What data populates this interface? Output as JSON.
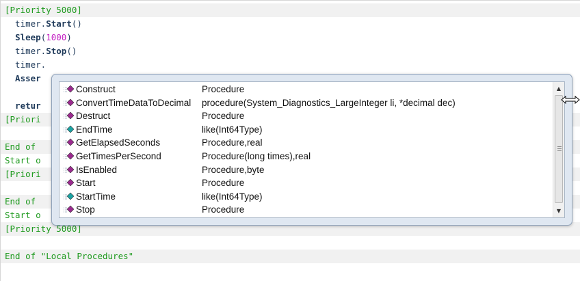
{
  "editor": {
    "lines": [
      {
        "text": "[Priority 5000]",
        "style": "green",
        "band": true
      },
      {
        "parts": [
          {
            "t": "  timer.",
            "c": "dark"
          },
          {
            "t": "Start",
            "c": "kw"
          },
          {
            "t": "()",
            "c": "dark"
          }
        ]
      },
      {
        "parts": [
          {
            "t": "  ",
            "c": "dark"
          },
          {
            "t": "Sleep",
            "c": "kw"
          },
          {
            "t": "(",
            "c": "dark"
          },
          {
            "t": "1000",
            "c": "num"
          },
          {
            "t": ")",
            "c": "dark"
          }
        ]
      },
      {
        "parts": [
          {
            "t": "  timer.",
            "c": "dark"
          },
          {
            "t": "Stop",
            "c": "kw"
          },
          {
            "t": "()",
            "c": "dark"
          }
        ]
      },
      {
        "parts": [
          {
            "t": "  timer.",
            "c": "dark"
          }
        ]
      },
      {
        "parts": [
          {
            "t": "  Asser",
            "c": "kw"
          }
        ]
      },
      {
        "parts": [
          {
            "t": "",
            "c": "dark"
          }
        ]
      },
      {
        "parts": [
          {
            "t": "  retur",
            "c": "kw"
          }
        ]
      },
      {
        "text": "[Priori",
        "style": "green",
        "band": true
      },
      {
        "parts": [
          {
            "t": "",
            "c": "dark"
          }
        ]
      },
      {
        "text": "End of ",
        "style": "green",
        "band": true
      },
      {
        "text": "Start o",
        "style": "green"
      },
      {
        "text": "[Priori",
        "style": "green",
        "band": true
      },
      {
        "parts": [
          {
            "t": "",
            "c": "dark"
          }
        ]
      },
      {
        "text": "End of ",
        "style": "green",
        "band": true
      },
      {
        "text": "Start o",
        "style": "green"
      },
      {
        "text": "[Priority 5000]",
        "style": "green",
        "band": true
      },
      {
        "parts": [
          {
            "t": "",
            "c": "dark"
          }
        ]
      },
      {
        "text": "End of \"Local Procedures\"",
        "style": "green",
        "band": true
      }
    ]
  },
  "autocomplete": {
    "items": [
      {
        "name": "Construct",
        "signature": "Procedure",
        "icon": "method-icon"
      },
      {
        "name": "ConvertTimeDataToDecimal",
        "signature": "procedure(System_Diagnostics_LargeInteger li, *decimal dec)",
        "icon": "method-icon"
      },
      {
        "name": "Destruct",
        "signature": "Procedure",
        "icon": "method-icon"
      },
      {
        "name": "EndTime",
        "signature": "like(Int64Type)",
        "icon": "property-icon"
      },
      {
        "name": "GetElapsedSeconds",
        "signature": "Procedure,real",
        "icon": "method-icon"
      },
      {
        "name": "GetTimesPerSecond",
        "signature": "Procedure(long times),real",
        "icon": "method-icon"
      },
      {
        "name": "IsEnabled",
        "signature": "Procedure,byte",
        "icon": "method-icon"
      },
      {
        "name": "Start",
        "signature": "Procedure",
        "icon": "method-icon"
      },
      {
        "name": "StartTime",
        "signature": "like(Int64Type)",
        "icon": "property-icon"
      },
      {
        "name": "Stop",
        "signature": "Procedure",
        "icon": "method-icon"
      }
    ],
    "scroll_up": "▲",
    "scroll_down": "▼"
  },
  "colors": {
    "method_icon": "#9b2a8f",
    "property_icon": "#1aa3a3",
    "comment_green": "#1e9a1e",
    "keyword_navy": "#1f3a5a",
    "number_magenta": "#c21fc2"
  }
}
